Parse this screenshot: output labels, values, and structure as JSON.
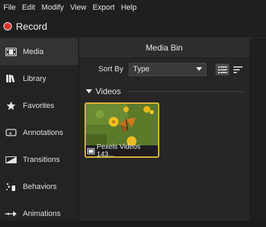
{
  "menu": [
    "File",
    "Edit",
    "Modify",
    "View",
    "Export",
    "Help"
  ],
  "record": {
    "label": "Record",
    "color": "#d8342b"
  },
  "sidebar": {
    "items": [
      {
        "label": "Media",
        "icon": "film-icon",
        "active": true
      },
      {
        "label": "Library",
        "icon": "books-icon"
      },
      {
        "label": "Favorites",
        "icon": "star-icon"
      },
      {
        "label": "Annotations",
        "icon": "annotation-icon"
      },
      {
        "label": "Transitions",
        "icon": "transition-icon"
      },
      {
        "label": "Behaviors",
        "icon": "behaviors-icon"
      },
      {
        "label": "Animations",
        "icon": "animations-icon"
      }
    ]
  },
  "media_bin": {
    "title": "Media Bin",
    "sort_label": "Sort By",
    "sort_value": "Type",
    "section": "Videos",
    "clips": [
      {
        "name": "Pexels Videos 143...",
        "selected": true
      }
    ]
  },
  "colors": {
    "selection": "#e0b53a",
    "accent": "#d8342b"
  }
}
